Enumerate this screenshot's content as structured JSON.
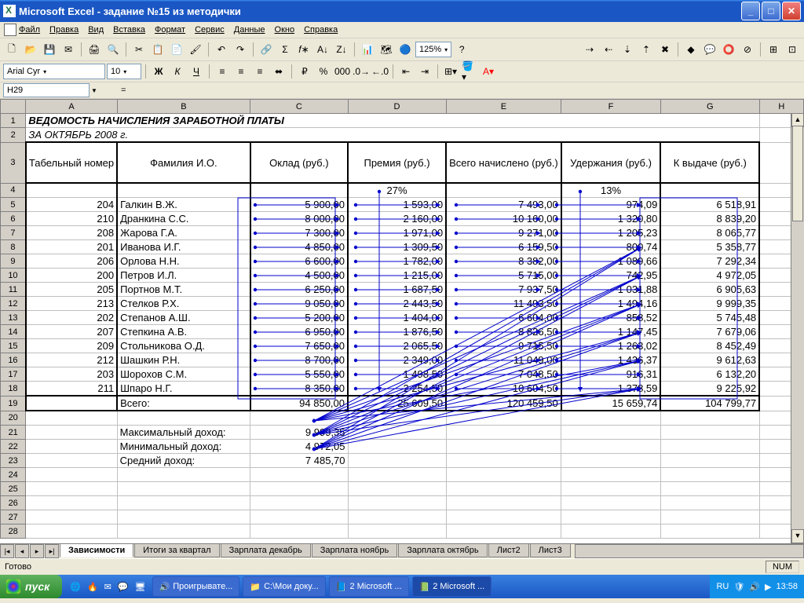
{
  "title": "Microsoft Excel - задание №15 из методички",
  "menu": [
    "Файл",
    "Правка",
    "Вид",
    "Вставка",
    "Формат",
    "Сервис",
    "Данные",
    "Окно",
    "Справка"
  ],
  "font": {
    "name": "Arial Cyr",
    "size": "10"
  },
  "zoom": "125%",
  "namebox": "H29",
  "cols": [
    "A",
    "B",
    "C",
    "D",
    "E",
    "F",
    "G",
    "H"
  ],
  "sheet": {
    "title1": "ВЕДОМОСТЬ НАЧИСЛЕНИЯ ЗАРАБОТНОЙ ПЛАТЫ",
    "title2": "ЗА ОКТЯБРЬ 2008 г.",
    "headers": [
      "Табельный номер",
      "Фамилия И.О.",
      "Оклад (руб.)",
      "Премия (руб.)",
      "Всего начислено (руб.)",
      "Удержания (руб.)",
      "К выдаче (руб.)"
    ],
    "pct": {
      "d": "27%",
      "f": "13%"
    },
    "rows": [
      {
        "n": "204",
        "name": "Галкин В.Ж.",
        "o": "5 900,00",
        "p": "1 593,00",
        "t": "7 493,00",
        "u": "974,09",
        "v": "6 518,91"
      },
      {
        "n": "210",
        "name": "Дранкина С.С.",
        "o": "8 000,00",
        "p": "2 160,00",
        "t": "10 160,00",
        "u": "1 320,80",
        "v": "8 839,20"
      },
      {
        "n": "208",
        "name": "Жарова Г.А.",
        "o": "7 300,00",
        "p": "1 971,00",
        "t": "9 271,00",
        "u": "1 205,23",
        "v": "8 065,77"
      },
      {
        "n": "201",
        "name": "Иванова И.Г.",
        "o": "4 850,00",
        "p": "1 309,50",
        "t": "6 159,50",
        "u": "800,74",
        "v": "5 358,77"
      },
      {
        "n": "206",
        "name": "Орлова Н.Н.",
        "o": "6 600,00",
        "p": "1 782,00",
        "t": "8 382,00",
        "u": "1 089,66",
        "v": "7 292,34"
      },
      {
        "n": "200",
        "name": "Петров И.Л.",
        "o": "4 500,00",
        "p": "1 215,00",
        "t": "5 715,00",
        "u": "742,95",
        "v": "4 972,05"
      },
      {
        "n": "205",
        "name": "Портнов М.Т.",
        "o": "6 250,00",
        "p": "1 687,50",
        "t": "7 937,50",
        "u": "1 031,88",
        "v": "6 905,63"
      },
      {
        "n": "213",
        "name": "Стелков Р.Х.",
        "o": "9 050,00",
        "p": "2 443,50",
        "t": "11 493,50",
        "u": "1 494,16",
        "v": "9 999,35"
      },
      {
        "n": "202",
        "name": "Степанов А.Ш.",
        "o": "5 200,00",
        "p": "1 404,00",
        "t": "6 604,00",
        "u": "858,52",
        "v": "5 745,48"
      },
      {
        "n": "207",
        "name": "Степкина А.В.",
        "o": "6 950,00",
        "p": "1 876,50",
        "t": "8 826,50",
        "u": "1 147,45",
        "v": "7 679,06"
      },
      {
        "n": "209",
        "name": "Стольникова О.Д.",
        "o": "7 650,00",
        "p": "2 065,50",
        "t": "9 715,50",
        "u": "1 263,02",
        "v": "8 452,49"
      },
      {
        "n": "212",
        "name": "Шашкин Р.Н.",
        "o": "8 700,00",
        "p": "2 349,00",
        "t": "11 049,00",
        "u": "1 436,37",
        "v": "9 612,63"
      },
      {
        "n": "203",
        "name": "Шорохов С.М.",
        "o": "5 550,00",
        "p": "1 498,50",
        "t": "7 048,50",
        "u": "916,31",
        "v": "6 132,20"
      },
      {
        "n": "211",
        "name": "Шпаро Н.Г.",
        "o": "8 350,00",
        "p": "2 254,50",
        "t": "10 604,50",
        "u": "1 378,59",
        "v": "9 225,92"
      }
    ],
    "total": {
      "label": "Всего:",
      "o": "94 850,00",
      "p": "25 609,50",
      "t": "120 459,50",
      "u": "15 659,74",
      "v": "104 799,77"
    },
    "stats": [
      {
        "label": "Максимальный доход:",
        "val": "9 999,35"
      },
      {
        "label": "Минимальный доход:",
        "val": "4 972,05"
      },
      {
        "label": "Средний доход:",
        "val": "7 485,70"
      }
    ]
  },
  "tabs": [
    "Зависимости",
    "Итоги за квартал",
    "Зарплата декабрь",
    "Зарплата ноябрь",
    "Зарплата октябрь",
    "Лист2",
    "Лист3"
  ],
  "status": {
    "ready": "Готово",
    "num": "NUM"
  },
  "taskbar": {
    "start": "пуск",
    "items": [
      "Проигрывате...",
      "С:\\Мои доку...",
      "2 Microsoft ...",
      "2 Microsoft ..."
    ],
    "lang": "RU",
    "clock": "13:58"
  }
}
